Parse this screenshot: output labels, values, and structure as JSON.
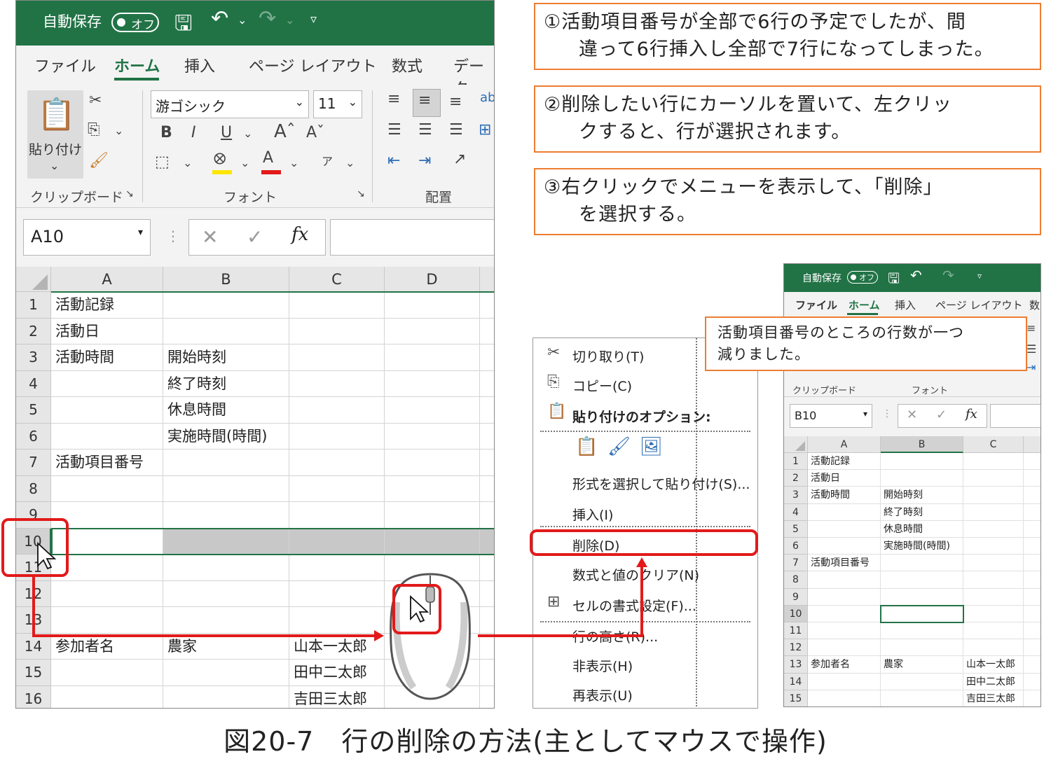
{
  "callouts": [
    {
      "line1": "①活動項目番号が全部で6行の予定でしたが、間",
      "line2": "違って6行挿入し全部で7行になってしまった。"
    },
    {
      "line1": "②削除したい行にカーソルを置いて、左クリッ",
      "line2": "クすると、行が選択されます。"
    },
    {
      "line1": "③右クリックでメニューを表示して、「削除」",
      "line2": "を選択する。"
    }
  ],
  "result_callout": {
    "line1": "活動項目番号のところの行数が一つ",
    "line2": "減りました。"
  },
  "caption": "図20-7　行の削除の方法(主としてマウスで操作)",
  "excel_left": {
    "autosave": "自動保存",
    "toggle": "オフ",
    "tabs": [
      "ファイル",
      "ホーム",
      "挿入",
      "ページ レイアウト",
      "数式",
      "データ"
    ],
    "paste_label": "貼り付け",
    "font_name": "游ゴシック",
    "font_size": "11",
    "group_clipboard": "クリップボード",
    "group_font": "フォント",
    "group_align": "配置",
    "name_box": "A10",
    "fx": "fx",
    "columns": [
      "A",
      "B",
      "C",
      "D"
    ],
    "rows": [
      {
        "n": "1",
        "a": "活動記録",
        "b": "",
        "c": ""
      },
      {
        "n": "2",
        "a": "活動日",
        "b": "",
        "c": ""
      },
      {
        "n": "3",
        "a": "活動時間",
        "b": "開始時刻",
        "c": ""
      },
      {
        "n": "4",
        "a": "",
        "b": "終了時刻",
        "c": ""
      },
      {
        "n": "5",
        "a": "",
        "b": "休息時間",
        "c": ""
      },
      {
        "n": "6",
        "a": "",
        "b": "実施時間(時間)",
        "c": ""
      },
      {
        "n": "7",
        "a": "活動項目番号",
        "b": "",
        "c": ""
      },
      {
        "n": "8",
        "a": "",
        "b": "",
        "c": ""
      },
      {
        "n": "9",
        "a": "",
        "b": "",
        "c": ""
      },
      {
        "n": "10",
        "a": "",
        "b": "",
        "c": ""
      },
      {
        "n": "11",
        "a": "",
        "b": "",
        "c": ""
      },
      {
        "n": "12",
        "a": "",
        "b": "",
        "c": ""
      },
      {
        "n": "13",
        "a": "",
        "b": "",
        "c": ""
      },
      {
        "n": "14",
        "a": "参加者名",
        "b": "農家",
        "c": "山本一太郎"
      },
      {
        "n": "15",
        "a": "",
        "b": "",
        "c": "田中二太郎"
      },
      {
        "n": "16",
        "a": "",
        "b": "",
        "c": "吉田三太郎"
      }
    ]
  },
  "context_menu": {
    "items": [
      "切り取り(T)",
      "コピー(C)",
      "貼り付けのオプション:",
      "形式を選択して貼り付け(S)...",
      "挿入(I)",
      "削除(D)",
      "数式と値のクリア(N)",
      "セルの書式設定(F)...",
      "行の高さ(R)...",
      "非表示(H)",
      "再表示(U)"
    ]
  },
  "excel_right": {
    "autosave": "自動保存",
    "toggle": "オフ",
    "tabs": [
      "ファイル",
      "ホーム",
      "挿入",
      "ページ レイアウト",
      "数"
    ],
    "group_clipboard": "クリップボード",
    "group_font": "フォント",
    "name_box": "B10",
    "fx": "fx",
    "columns": [
      "A",
      "B",
      "C"
    ],
    "rows": [
      {
        "n": "1",
        "a": "活動記録",
        "b": "",
        "c": ""
      },
      {
        "n": "2",
        "a": "活動日",
        "b": "",
        "c": ""
      },
      {
        "n": "3",
        "a": "活動時間",
        "b": "開始時刻",
        "c": ""
      },
      {
        "n": "4",
        "a": "",
        "b": "終了時刻",
        "c": ""
      },
      {
        "n": "5",
        "a": "",
        "b": "休息時間",
        "c": ""
      },
      {
        "n": "6",
        "a": "",
        "b": "実施時間(時間)",
        "c": ""
      },
      {
        "n": "7",
        "a": "活動項目番号",
        "b": "",
        "c": ""
      },
      {
        "n": "8",
        "a": "",
        "b": "",
        "c": ""
      },
      {
        "n": "9",
        "a": "",
        "b": "",
        "c": ""
      },
      {
        "n": "10",
        "a": "",
        "b": "",
        "c": ""
      },
      {
        "n": "11",
        "a": "",
        "b": "",
        "c": ""
      },
      {
        "n": "12",
        "a": "",
        "b": "",
        "c": ""
      },
      {
        "n": "13",
        "a": "参加者名",
        "b": "農家",
        "c": "山本一太郎"
      },
      {
        "n": "14",
        "a": "",
        "b": "",
        "c": "田中二太郎"
      },
      {
        "n": "15",
        "a": "",
        "b": "",
        "c": "吉田三太郎"
      }
    ]
  },
  "colors": {
    "excel_green": "#217346",
    "callout_border": "#ed7d31",
    "highlight_red": "#e21a1a"
  }
}
